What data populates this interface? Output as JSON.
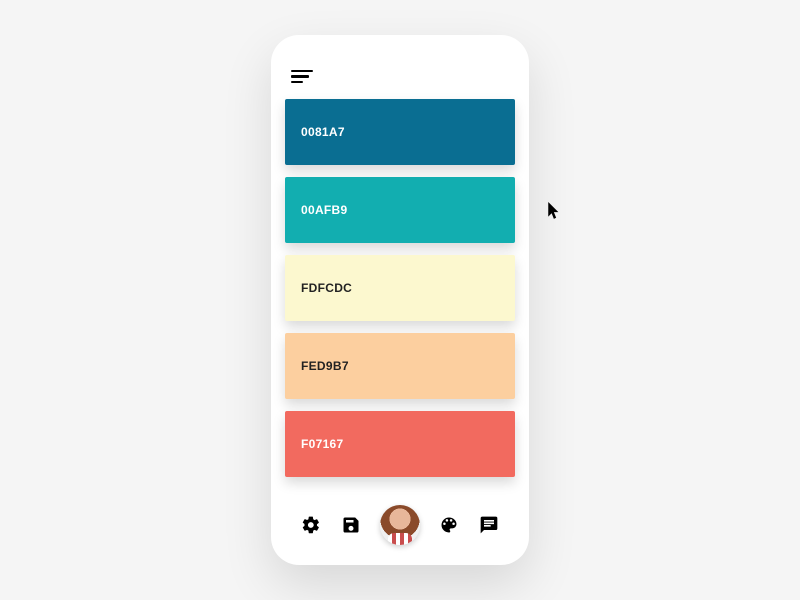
{
  "palette": [
    {
      "hex": "0081A7",
      "bg": "#0a6e92",
      "text": "light"
    },
    {
      "hex": "00AFB9",
      "bg": "#12aeb0",
      "text": "light"
    },
    {
      "hex": "FDFCDC",
      "bg": "#fcf8cf",
      "text": "dark"
    },
    {
      "hex": "FED9B7",
      "bg": "#fccf9f",
      "text": "dark"
    },
    {
      "hex": "F07167",
      "bg": "#f26a5f",
      "text": "light"
    }
  ],
  "nav": {
    "settings": "settings",
    "save": "save",
    "palette": "palette",
    "chat": "chat"
  }
}
